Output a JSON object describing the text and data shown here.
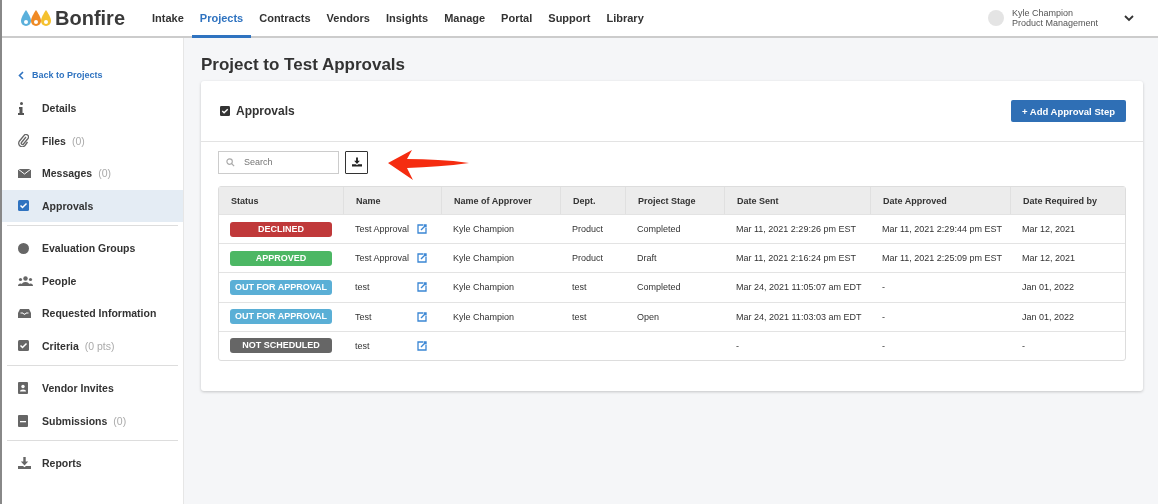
{
  "brand": {
    "name": "Bonfire"
  },
  "nav": [
    {
      "label": "Intake",
      "selected": false
    },
    {
      "label": "Projects",
      "selected": true
    },
    {
      "label": "Contracts",
      "selected": false
    },
    {
      "label": "Vendors",
      "selected": false
    },
    {
      "label": "Insights",
      "selected": false
    },
    {
      "label": "Manage",
      "selected": false
    },
    {
      "label": "Portal",
      "selected": false
    },
    {
      "label": "Support",
      "selected": false
    },
    {
      "label": "Library",
      "selected": false
    }
  ],
  "user": {
    "name": "Kyle Champion",
    "role": "Product Management"
  },
  "sidebar": {
    "back": "Back to Projects",
    "groups": [
      [
        {
          "label": "Details",
          "kind": "info",
          "selected": false
        },
        {
          "label": "Files",
          "count": "(0)",
          "kind": "clip",
          "selected": false
        },
        {
          "label": "Messages",
          "count": "(0)",
          "kind": "mail",
          "selected": false
        },
        {
          "label": "Approvals",
          "kind": "check",
          "selected": true
        }
      ],
      [
        {
          "label": "Evaluation Groups",
          "kind": "dot",
          "selected": false
        },
        {
          "label": "People",
          "kind": "people",
          "selected": false
        },
        {
          "label": "Requested Information",
          "kind": "inbox",
          "selected": false
        },
        {
          "label": "Criteria",
          "count": "(0 pts)",
          "kind": "check",
          "selected": false
        }
      ],
      [
        {
          "label": "Vendor Invites",
          "kind": "contact",
          "selected": false
        },
        {
          "label": "Submissions",
          "count": "(0)",
          "kind": "doc",
          "selected": false
        }
      ],
      [
        {
          "label": "Reports",
          "kind": "download",
          "selected": false
        }
      ]
    ]
  },
  "page_title": "Project to Test Approvals",
  "card": {
    "title": "Approvals",
    "add_button": "+ Add Approval Step",
    "search": {
      "placeholder": "Search"
    }
  },
  "table": {
    "columns": [
      "Status",
      "Name",
      "Name of Approver",
      "Dept.",
      "Project Stage",
      "Date Sent",
      "Date Approved",
      "Date Required by"
    ],
    "rows": [
      {
        "status": "DECLINED",
        "color": "#c0393a",
        "name": "Test Approval",
        "approver": "Kyle Champion",
        "dept": "Product",
        "stage": "Completed",
        "sent": "Mar 11, 2021 2:29:26 pm EST",
        "approved": "Mar 11, 2021 2:29:44 pm EST",
        "required": "Mar 12, 2021"
      },
      {
        "status": "APPROVED",
        "color": "#4cb764",
        "name": "Test Approval",
        "approver": "Kyle Champion",
        "dept": "Product",
        "stage": "Draft",
        "sent": "Mar 11, 2021 2:16:24 pm EST",
        "approved": "Mar 11, 2021 2:25:09 pm EST",
        "required": "Mar 12, 2021"
      },
      {
        "status": "OUT FOR APPROVAL",
        "color": "#5aafd6",
        "name": "test",
        "approver": "Kyle Champion",
        "dept": "test",
        "stage": "Completed",
        "sent": "Mar 24, 2021 11:05:07 am EDT",
        "approved": "-",
        "required": "Jan 01, 2022"
      },
      {
        "status": "OUT FOR APPROVAL",
        "color": "#5aafd6",
        "name": "Test",
        "approver": "Kyle Champion",
        "dept": "test",
        "stage": "Open",
        "sent": "Mar 24, 2021 11:03:03 am EDT",
        "approved": "-",
        "required": "Jan 01, 2022"
      },
      {
        "status": "NOT SCHEDULED",
        "color": "#666666",
        "name": "test",
        "sent": "-",
        "approved": "-",
        "required": "-"
      }
    ]
  }
}
